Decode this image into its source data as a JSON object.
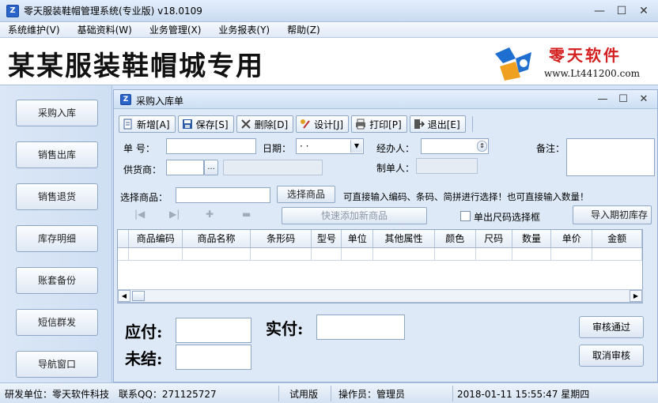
{
  "window": {
    "title": "零天服装鞋帽管理系统(专业版)  v18.0109",
    "minimize": "—",
    "maximize": "☐",
    "close": "✕"
  },
  "menu": [
    "系统维护(V)",
    "基础资料(W)",
    "业务管理(X)",
    "业务报表(Y)",
    "帮助(Z)"
  ],
  "banner": {
    "title": "某某服装鞋帽城专用",
    "logo_name": "零天软件",
    "logo_url": "www.Lt441200.com",
    "logo_colors": [
      "#1f6fd0",
      "#f0a020",
      "#d42020"
    ]
  },
  "sidebar": [
    "采购入库",
    "销售出库",
    "销售退货",
    "库存明细",
    "账套备份",
    "短信群发",
    "导航窗口"
  ],
  "inner_window": {
    "title": "采购入库单",
    "minimize": "—",
    "maximize": "☐",
    "close": "✕"
  },
  "toolbar": [
    {
      "label": "新增[A]",
      "icon": "new-doc-icon"
    },
    {
      "label": "保存[S]",
      "icon": "save-icon"
    },
    {
      "label": "删除[D]",
      "icon": "delete-icon"
    },
    {
      "label": "设计[J]",
      "icon": "design-icon"
    },
    {
      "label": "打印[P]",
      "icon": "print-icon"
    },
    {
      "label": "退出[E]",
      "icon": "exit-icon"
    }
  ],
  "form": {
    "doc_no_label": "单  号：",
    "doc_no": "",
    "date_label": "日期：",
    "date_value": " · ·",
    "handler_label": "经办人：",
    "handler": "",
    "remark_label": "备注：",
    "remark": "",
    "supplier_label": "供货商：",
    "supplier": "",
    "supplier_browse": "...",
    "creator_label": "制单人：",
    "creator": "",
    "select_goods_label": "选择商品：",
    "select_goods": "",
    "select_goods_button": "选择商品",
    "hint": "可直接输入编码、条码、简拼进行选择！也可直接输入数量！",
    "quick_add_button": "快速添加新商品",
    "size_checkbox_label": "单出尺码选择框",
    "import_button": "导入期初库存"
  },
  "grid": {
    "columns": [
      "商品编码",
      "商品名称",
      "条形码",
      "型号",
      "单位",
      "其他属性",
      "颜色",
      "尺码",
      "数量",
      "单价",
      "金额"
    ],
    "rows": []
  },
  "payment": {
    "payable_label": "应付:",
    "payable": "",
    "paid_label": "实付:",
    "paid": "",
    "unsettled_label": "未结:",
    "unsettled": "",
    "approve_button": "审核通过",
    "cancel_approve_button": "取消审核"
  },
  "status": {
    "developer": "研发单位：零天软件科技",
    "qq": "联系QQ：271125727",
    "edition": "试用版",
    "operator": "操作员：管理员",
    "datetime": "2018-01-11  15:55:47 星期四"
  }
}
